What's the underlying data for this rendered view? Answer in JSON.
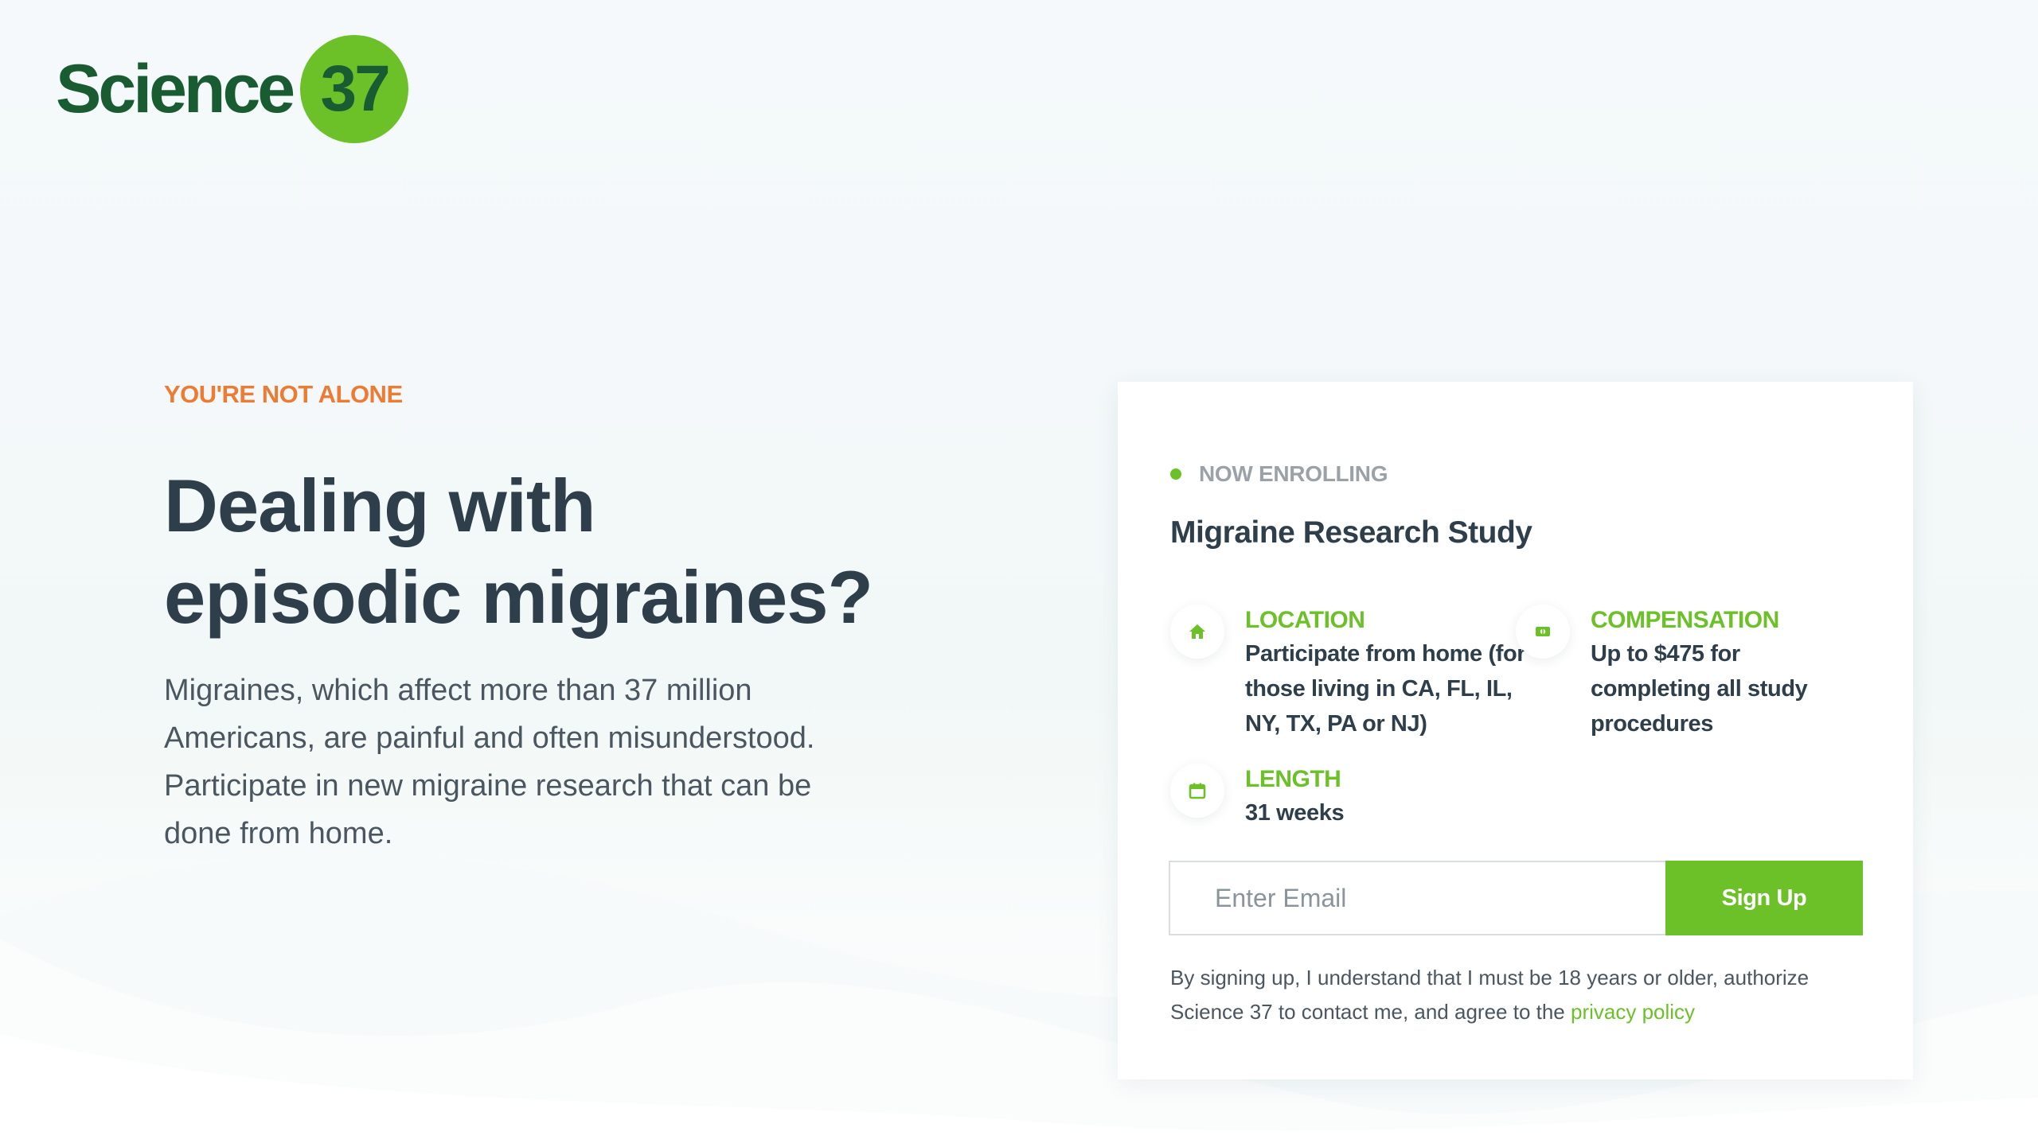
{
  "brand": {
    "wordmark": "Science",
    "badge": "37",
    "colors": {
      "dark_green": "#1a5c32",
      "accent_green": "#6cc028",
      "orange": "#ec7c34",
      "heading": "#2e3f4b"
    }
  },
  "hero": {
    "eyebrow": "YOU'RE NOT ALONE",
    "headline_line1": "Dealing with",
    "headline_line2": "episodic migraines?",
    "description": "Migraines, which affect more than 37 million Americans, are painful and often misunderstood. Participate in new migraine research that can be done from home."
  },
  "card": {
    "status": "NOW ENROLLING",
    "title": "Migraine Research Study",
    "info": {
      "location": {
        "icon": "home-icon",
        "label": "LOCATION",
        "value": "Participate from home (for those living in CA, FL, IL, NY, TX, PA or NJ)"
      },
      "compensation": {
        "icon": "dollar-icon",
        "label": "COMPENSATION",
        "value": "Up to $475 for completing all study procedures"
      },
      "length": {
        "icon": "calendar-icon",
        "label": "LENGTH",
        "value": "31 weeks"
      }
    },
    "form": {
      "email_value": "",
      "email_placeholder": "Enter Email",
      "button_label": "Sign Up"
    },
    "disclaimer": {
      "text": "By signing up, I understand that I must be 18 years or older, authorize Science 37 to contact me, and agree to the ",
      "link_label": "privacy policy"
    }
  }
}
